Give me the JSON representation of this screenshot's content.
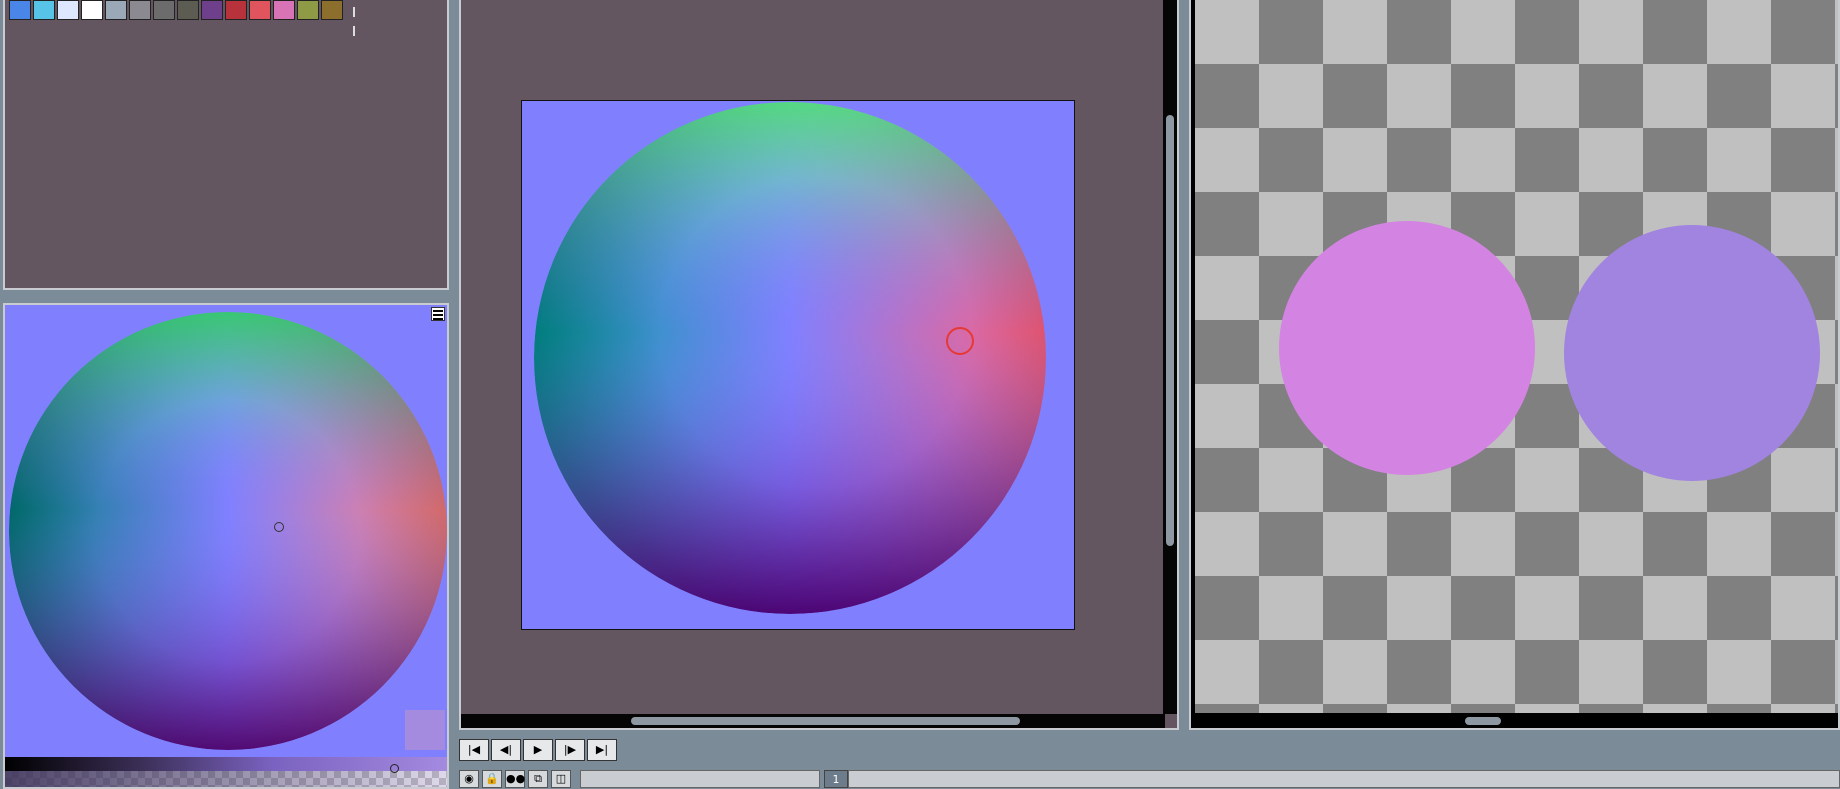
{
  "palette": {
    "colors": [
      "#4a86e8",
      "#57c3e6",
      "#dde7ff",
      "#ffffff",
      "#9aa8b8",
      "#8a8a90",
      "#6c6c6c",
      "#5c5c52",
      "#6e3f8a",
      "#b8323c",
      "#e0545e",
      "#d873b6",
      "#8e9a46",
      "#8c6f2c"
    ]
  },
  "picker": {
    "current_color": "#a58be0"
  },
  "canvas": {
    "background": "#8080ff",
    "brush_color": "#e53935"
  },
  "preview": {
    "blob_colors": [
      "#d383e2",
      "#a183e0"
    ]
  },
  "animation": {
    "buttons": [
      {
        "name": "first-frame-button",
        "icon": "|◀"
      },
      {
        "name": "prev-frame-button",
        "icon": "◀|"
      },
      {
        "name": "play-button",
        "icon": "▶"
      },
      {
        "name": "next-frame-button",
        "icon": "|▶"
      },
      {
        "name": "last-frame-button",
        "icon": "▶|"
      }
    ]
  },
  "status": {
    "icons": [
      {
        "name": "eye-icon",
        "glyph": "◉"
      },
      {
        "name": "lock-icon",
        "glyph": "🔒"
      },
      {
        "name": "onion-skin-icon",
        "glyph": "●●"
      },
      {
        "name": "link-icon",
        "glyph": "⧉"
      },
      {
        "name": "layer-mode-icon",
        "glyph": "◫"
      }
    ],
    "frame": "1"
  }
}
